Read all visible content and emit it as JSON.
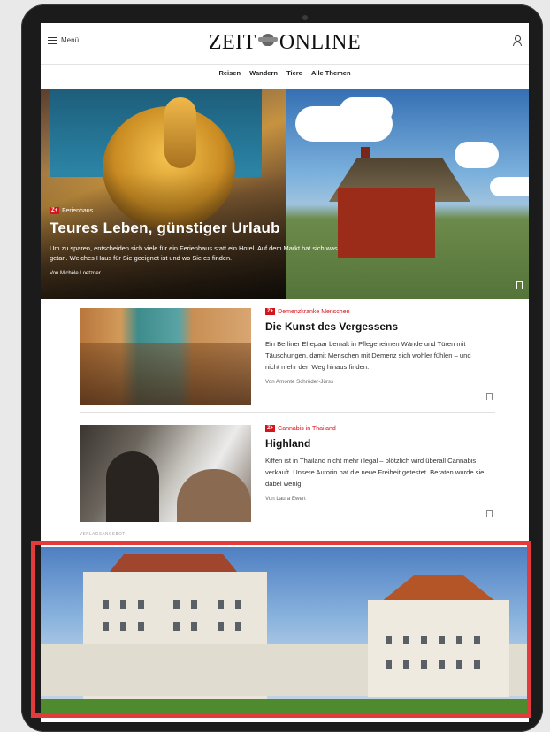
{
  "header": {
    "menu_label": "Menü",
    "logo_left": "ZEIT",
    "logo_right": "ONLINE"
  },
  "nav": {
    "items": [
      "Reisen",
      "Wandern",
      "Tiere",
      "Alle Themen"
    ]
  },
  "hero": {
    "kicker_badge": "Z+",
    "kicker": "Ferienhaus",
    "title": "Teures Leben, günstiger Urlaub",
    "lead": "Um zu sparen, entscheiden sich viele für ein Ferienhaus statt ein Hotel. Auf dem Markt hat sich was getan. Welches Haus für Sie geeignet ist und wo Sie es finden.",
    "author": "Von Michèle Loetzner"
  },
  "articles": [
    {
      "kicker_badge": "Z+",
      "kicker": "Demenzkranke Menschen",
      "title": "Die Kunst des Vergessens",
      "lead": "Ein Berliner Ehepaar bemalt in Pflegeheimen Wände und Türen mit Täuschungen, damit Menschen mit Demenz sich wohler fühlen – und nicht mehr den Weg hinaus finden.",
      "author": "Von Amonte Schröder-Jürss"
    },
    {
      "kicker_badge": "Z+",
      "kicker": "Cannabis in Thailand",
      "title": "Highland",
      "lead": "Kiffen ist in Thailand nicht mehr illegal – plötzlich wird überall Cannabis verkauft. Unsere Autorin hat die neue Freiheit getestet. Beraten wurde sie dabei wenig.",
      "author": "Von Laura Ewert"
    }
  ],
  "ad": {
    "label": "VERLAGSANGEBOT"
  },
  "colors": {
    "accent": "#d3151c",
    "highlight_frame": "#e33b3b"
  }
}
